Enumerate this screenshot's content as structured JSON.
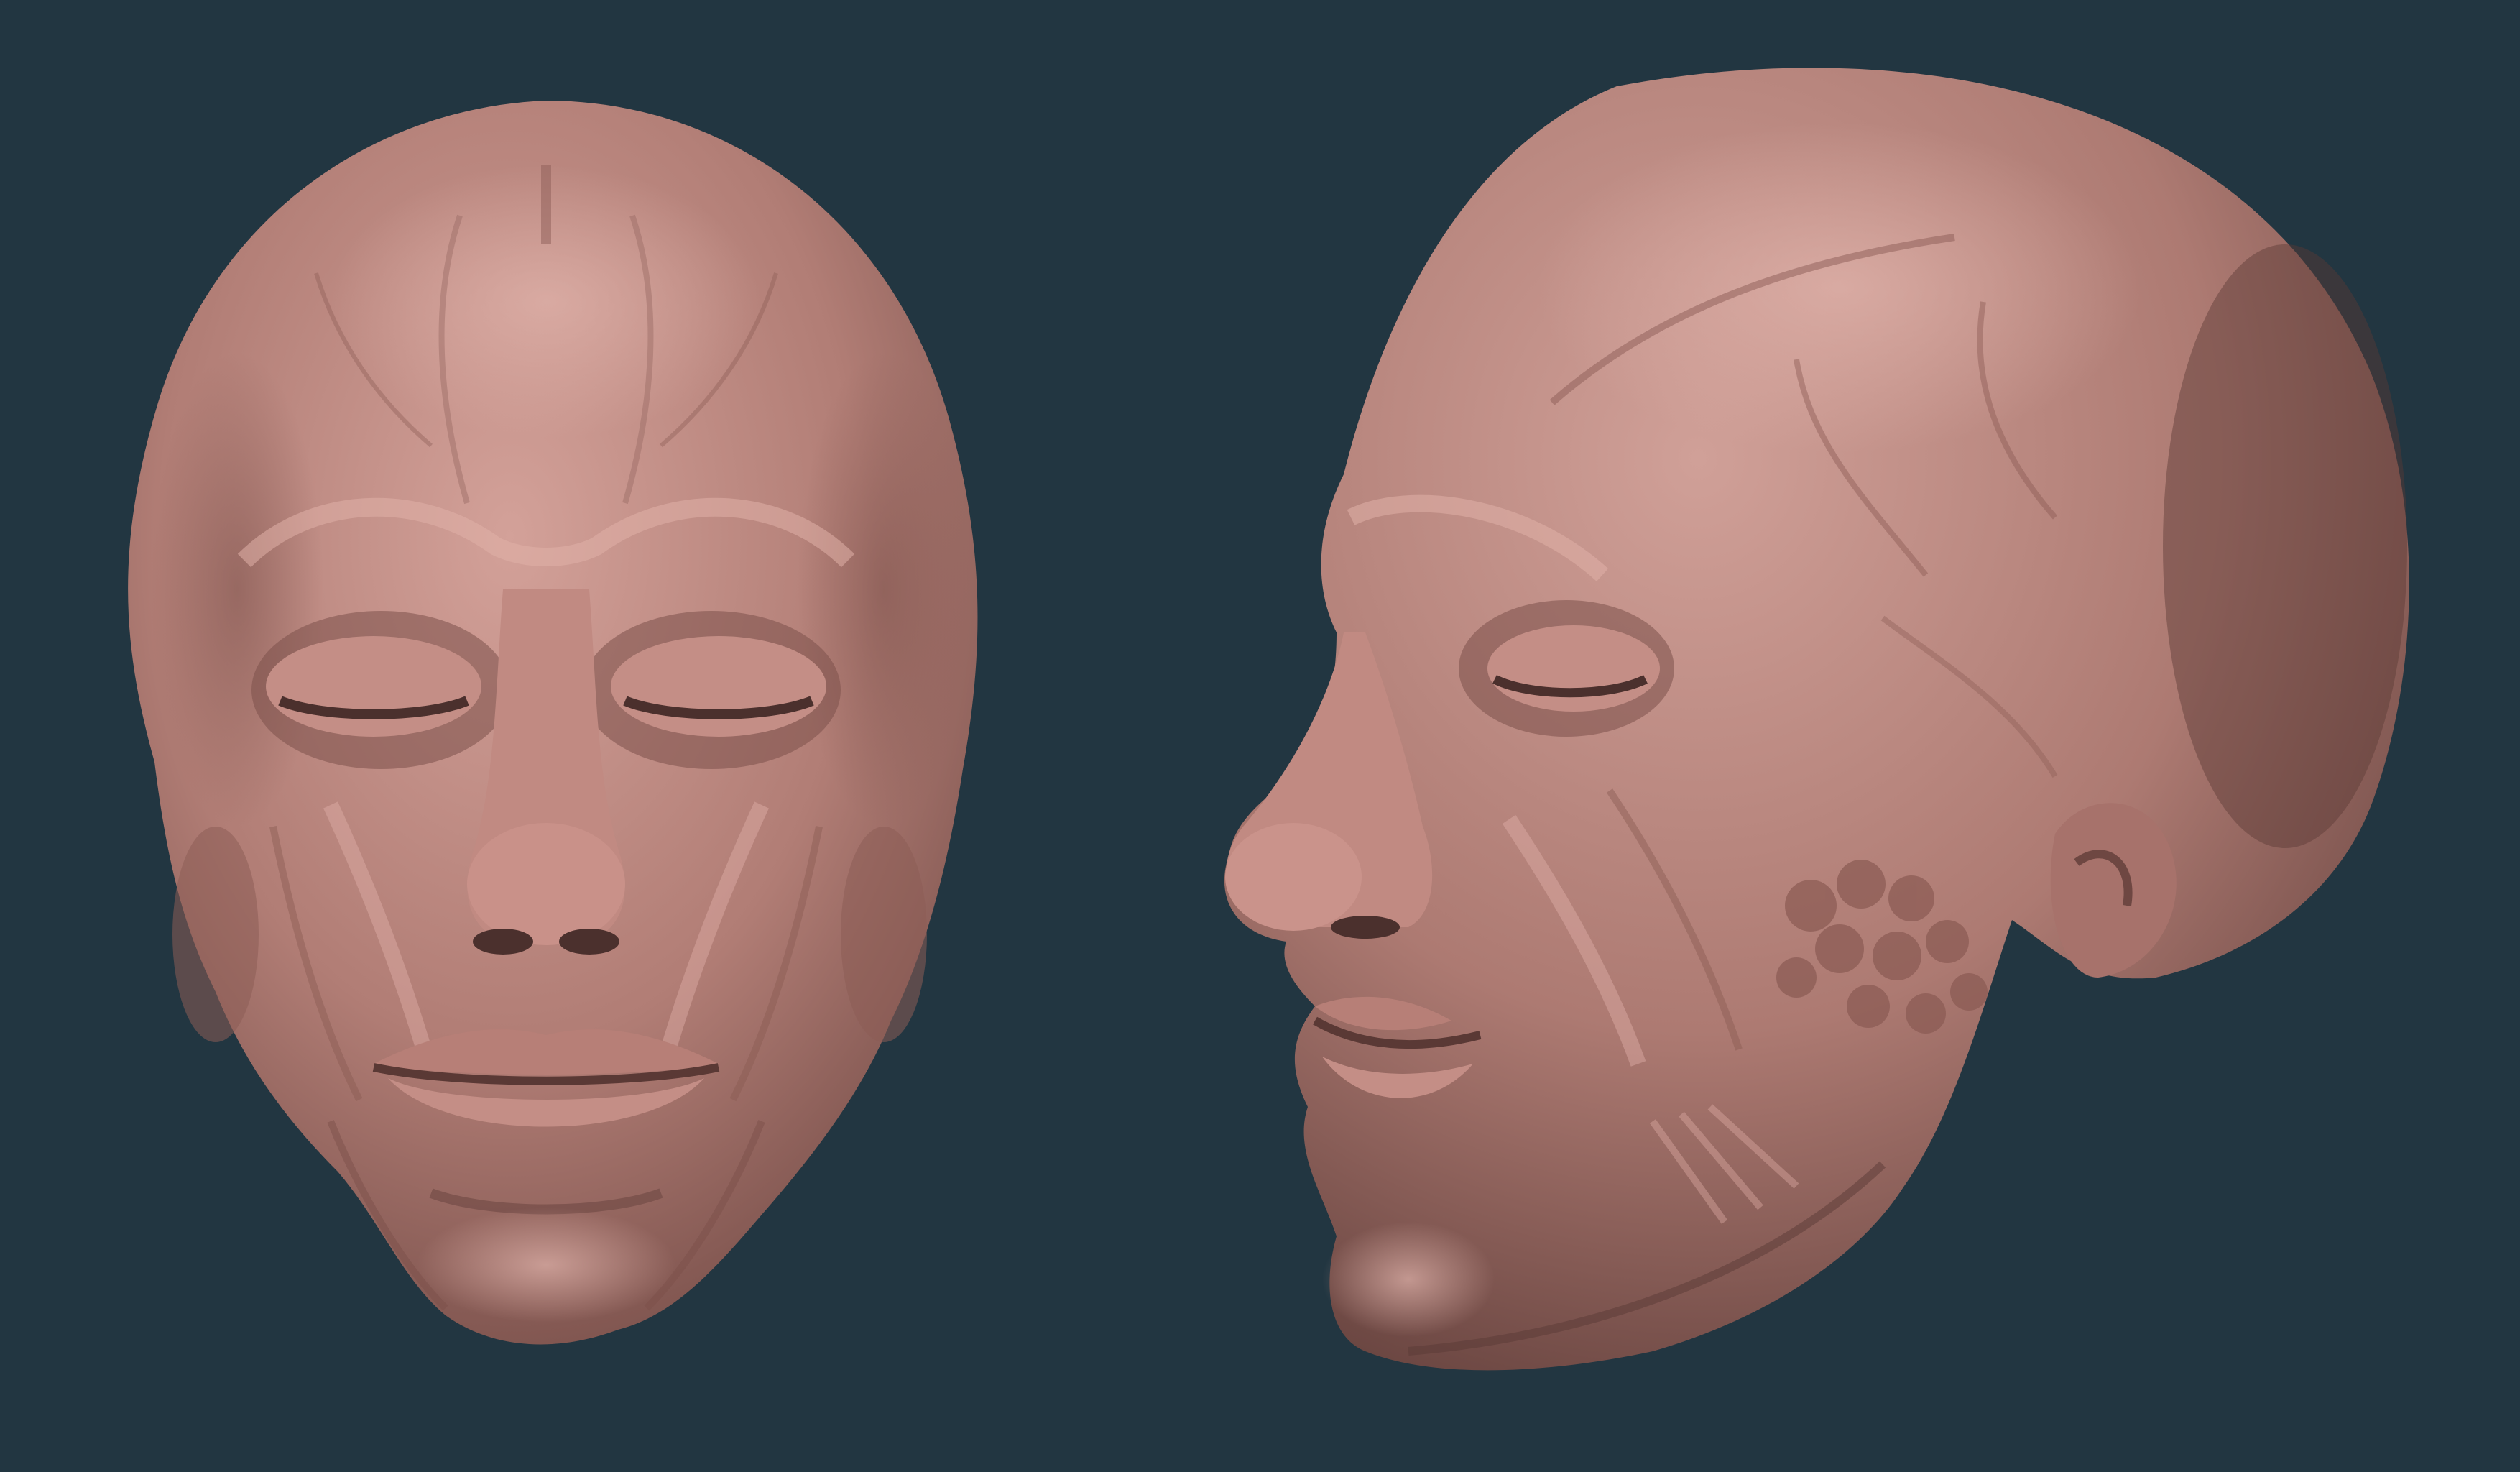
{
  "colors": {
    "background": "#223641",
    "clay_light": "#c9968e",
    "clay_mid": "#a7726b",
    "clay_dark": "#6e4742",
    "clay_shadow": "#4b302d"
  },
  "scene": {
    "subjects": [
      "front-view-head-sculpt",
      "three-quarter-view-head-sculpt"
    ]
  }
}
